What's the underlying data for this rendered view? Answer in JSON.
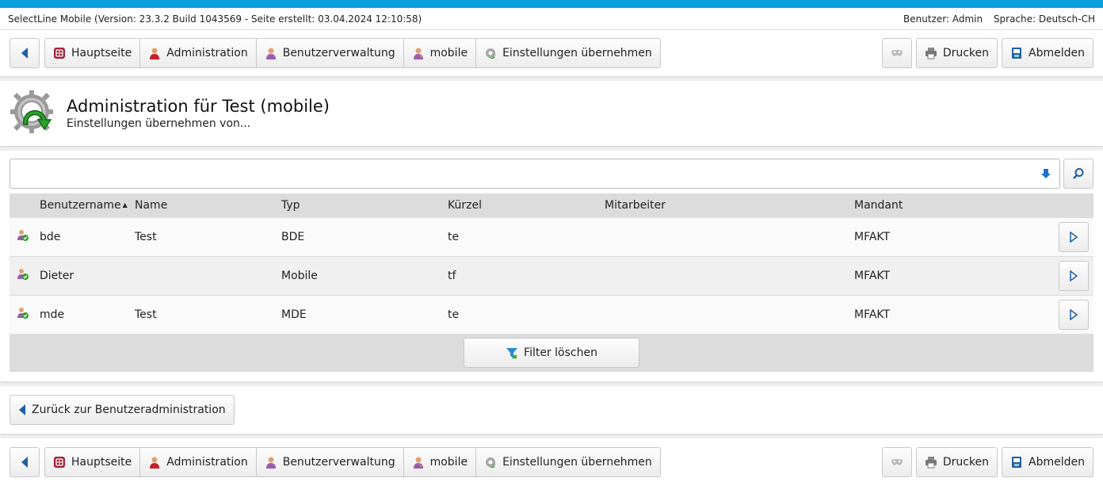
{
  "info": {
    "version_text": "SelectLine Mobile (Version: 23.3.2 Build 1043569 - Seite erstellt: 03.04.2024 12:10:58)",
    "user_text": "Benutzer: Admin",
    "language_text": "Sprache: Deutsch-CH"
  },
  "nav": {
    "crumbs": [
      "Hauptseite",
      "Administration",
      "Benutzerverwaltung",
      "mobile",
      "Einstellungen übernehmen"
    ],
    "print_label": "Drucken",
    "logout_label": "Abmelden"
  },
  "header": {
    "title": "Administration für Test (mobile)",
    "subtitle": "Einstellungen übernehmen von..."
  },
  "search": {
    "value": ""
  },
  "table": {
    "columns": [
      "Benutzername",
      "Name",
      "Typ",
      "Kürzel",
      "Mitarbeiter",
      "Mandant"
    ],
    "sort_indicator": "▲",
    "rows": [
      [
        "bde",
        "Test",
        "BDE",
        "te",
        "",
        "MFAKT"
      ],
      [
        "Dieter",
        "",
        "Mobile",
        "tf",
        "",
        "MFAKT"
      ],
      [
        "mde",
        "Test",
        "MDE",
        "te",
        "",
        "MFAKT"
      ]
    ],
    "filter_clear_label": "Filter löschen"
  },
  "back": {
    "label": "Zurück zur Benutzeradministration"
  },
  "colors": {
    "accent": "#0aa0dc",
    "nav_arrow": "#1f5fa8"
  }
}
